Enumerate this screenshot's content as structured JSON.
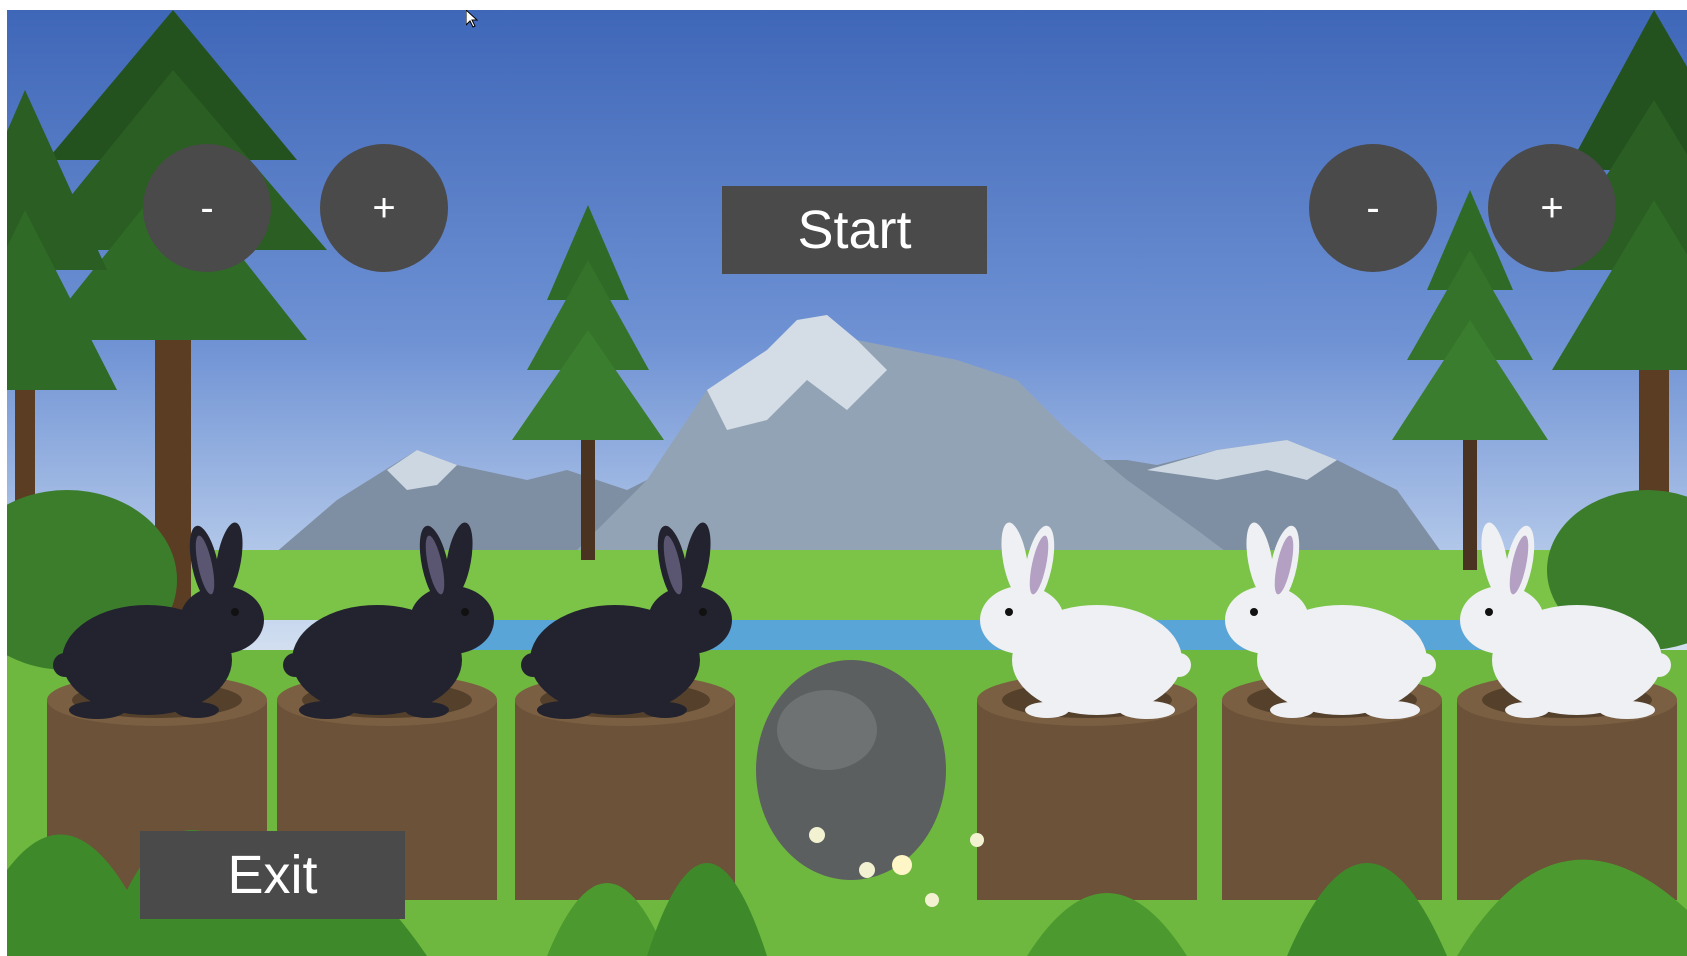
{
  "hud": {
    "left_minus_label": "-",
    "left_plus_label": "+",
    "right_minus_label": "-",
    "right_plus_label": "+",
    "start_label": "Start",
    "exit_label": "Exit"
  },
  "scene": {
    "rabbits": [
      {
        "color": "dark",
        "fur": "#22232f",
        "ear": "#5a5570"
      },
      {
        "color": "dark",
        "fur": "#22232f",
        "ear": "#5a5570"
      },
      {
        "color": "dark",
        "fur": "#22232f",
        "ear": "#5a5570"
      },
      {
        "color": "white",
        "fur": "#eef0f3",
        "ear": "#b3a0c3"
      },
      {
        "color": "white",
        "fur": "#eef0f3",
        "ear": "#b3a0c3"
      },
      {
        "color": "white",
        "fur": "#eef0f3",
        "ear": "#b3a0c3"
      }
    ],
    "colors": {
      "button": "#4a4a4a",
      "button_text": "#ffffff",
      "grass": "#78c24a",
      "stump": "#6b5238",
      "rock": "#5c5f60",
      "water": "#5aa5d8",
      "mountain": "#9aa8b8"
    }
  }
}
